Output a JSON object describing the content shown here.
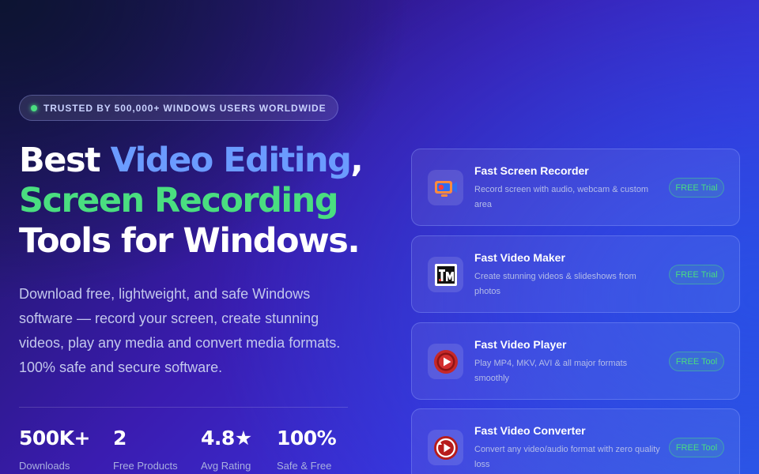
{
  "badge": {
    "text": "TRUSTED BY 500,000+ WINDOWS USERS WORLDWIDE"
  },
  "hero": {
    "line1_a": "Best ",
    "line1_b": "Video Editing",
    "line1_c": ",",
    "line2": "Screen Recording",
    "line3": "Tools for Windows."
  },
  "lead": "Download free, lightweight, and safe Windows software — record your screen, create stunning videos, play any media and convert media formats. 100% safe and secure software.",
  "stats": [
    {
      "value": "500K+",
      "label": "Downloads"
    },
    {
      "value": "2",
      "label": "Free Products"
    },
    {
      "value": "4.8★",
      "label": "Avg Rating"
    },
    {
      "value": "100%",
      "label": "Safe & Free"
    }
  ],
  "products": [
    {
      "name": "Fast Screen Recorder",
      "desc": "Record screen with audio, webcam & custom area",
      "badge": "FREE Trial",
      "icon": "screen-recorder-icon"
    },
    {
      "name": "Fast Video Maker",
      "desc": "Create stunning videos & slideshows from photos",
      "badge": "FREE Trial",
      "icon": "video-maker-icon"
    },
    {
      "name": "Fast Video Player",
      "desc": "Play MP4, MKV, AVI & all major formats smoothly",
      "badge": "FREE Tool",
      "icon": "video-player-icon"
    },
    {
      "name": "Fast Video Converter",
      "desc": "Convert any video/audio format with zero quality loss",
      "badge": "FREE Tool",
      "icon": "video-converter-icon"
    }
  ],
  "colors": {
    "accent_blue": "#6b9bff",
    "accent_green": "#4ade80"
  }
}
